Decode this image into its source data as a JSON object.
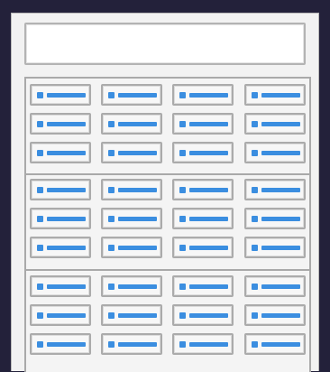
{
  "form": {
    "text_field_value": "",
    "accent_color": "#3b8ee0",
    "groups": [
      {
        "rows": [
          {
            "cells": [
              "",
              "",
              "",
              ""
            ]
          },
          {
            "cells": [
              "",
              "",
              "",
              ""
            ]
          },
          {
            "cells": [
              "",
              "",
              "",
              ""
            ]
          }
        ]
      },
      {
        "rows": [
          {
            "cells": [
              "",
              "",
              "",
              ""
            ]
          },
          {
            "cells": [
              "",
              "",
              "",
              ""
            ]
          },
          {
            "cells": [
              "",
              "",
              "",
              ""
            ]
          }
        ]
      },
      {
        "rows": [
          {
            "cells": [
              "",
              "",
              "",
              ""
            ]
          },
          {
            "cells": [
              "",
              "",
              "",
              ""
            ]
          },
          {
            "cells": [
              "",
              "",
              "",
              ""
            ]
          }
        ]
      }
    ]
  }
}
